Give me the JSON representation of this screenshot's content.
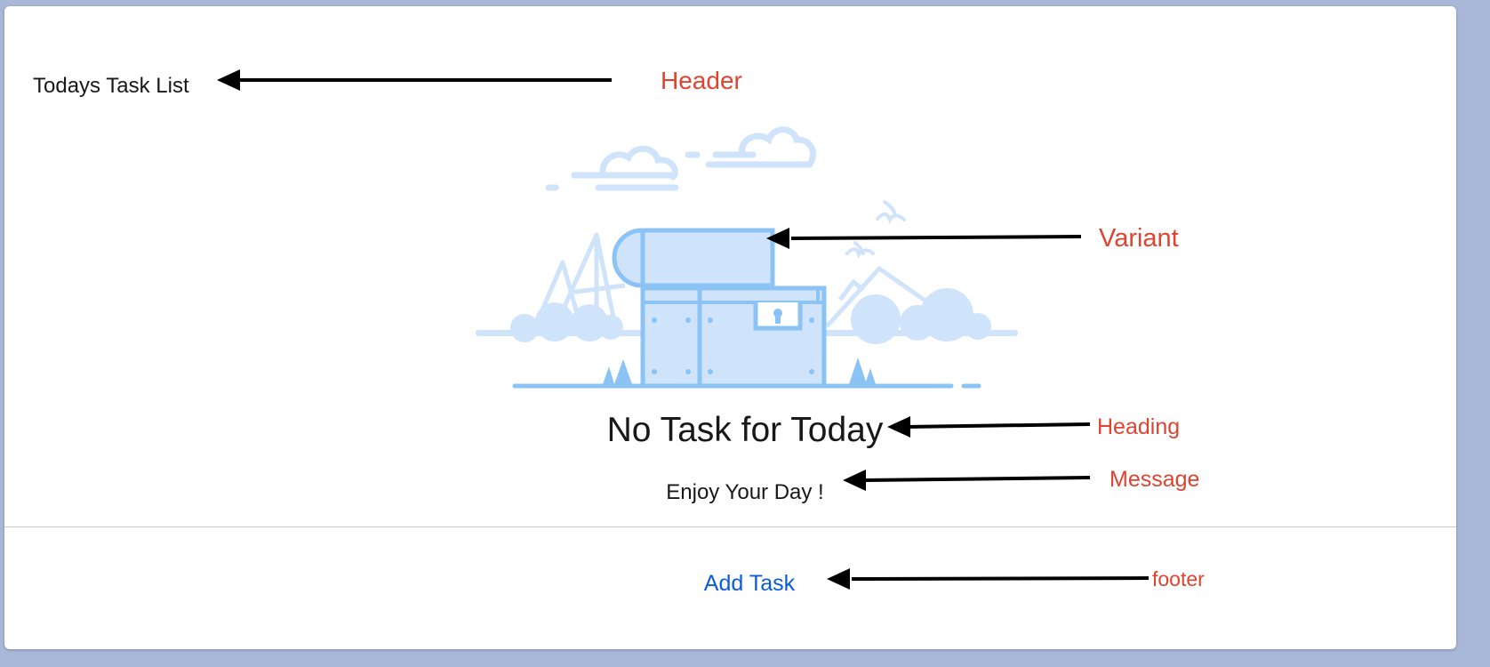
{
  "card": {
    "header_title": "Todays Task List",
    "heading": "No Task for Today",
    "message": "Enjoy Your Day !",
    "footer_link": "Add Task"
  },
  "illustration": {
    "name": "open-treasure-chest-illustration",
    "color": "#8cc3f5",
    "fill_color": "#cfe3fb"
  },
  "annotations": {
    "header": "Header",
    "variant": "Variant",
    "heading": "Heading",
    "message": "Message",
    "footer": "footer"
  },
  "colors": {
    "background": "#a9b8d8",
    "annotation_text": "#e0432f",
    "link": "#0b5cd5",
    "text": "#181818",
    "arrow": "#000000"
  }
}
